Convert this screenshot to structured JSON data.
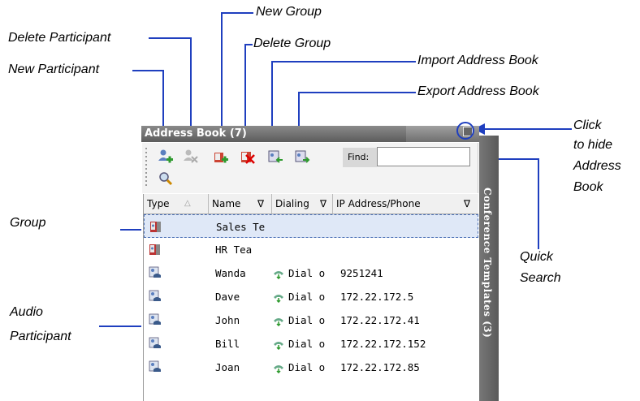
{
  "callouts": {
    "new_group": "New Group",
    "delete_participant": "Delete Participant",
    "delete_group": "Delete Group",
    "import_address_book": "Import Address Book",
    "new_participant": "New Participant",
    "export_address_book": "Export Address Book",
    "click_to_hide_1": "Click",
    "click_to_hide_2": "to hide",
    "click_to_hide_3": "Address",
    "click_to_hide_4": "Book",
    "group": "Group",
    "quick_search_1": "Quick",
    "quick_search_2": "Search",
    "audio_participant_1": "Audio",
    "audio_participant_2": "Participant"
  },
  "panel": {
    "title": "Address Book (7)",
    "find_label": "Find:",
    "find_value": "",
    "side_tab": "Conference Templates (3)"
  },
  "grid": {
    "headers": [
      "Type",
      "Name",
      "Dialing",
      "IP Address/Phone"
    ],
    "rows": [
      {
        "type_icon": "group-icon",
        "name": "Sales Te",
        "dialing": "",
        "address": ""
      },
      {
        "type_icon": "group-icon",
        "name": "HR Tea",
        "dialing": "",
        "address": ""
      },
      {
        "type_icon": "audio-participant-icon",
        "name": "Wanda",
        "dialing": "Dial o",
        "address": "9251241"
      },
      {
        "type_icon": "audio-participant-icon",
        "name": "Dave",
        "dialing": "Dial o",
        "address": "172.22.172.5"
      },
      {
        "type_icon": "audio-participant-icon",
        "name": "John",
        "dialing": "Dial o",
        "address": "172.22.172.41"
      },
      {
        "type_icon": "audio-participant-icon",
        "name": "Bill",
        "dialing": "Dial o",
        "address": "172.22.172.152"
      },
      {
        "type_icon": "audio-participant-icon",
        "name": "Joan",
        "dialing": "Dial o",
        "address": "172.22.172.85"
      }
    ]
  },
  "colors": {
    "callout_line": "#1f3fbf",
    "titlebar": "#6b6b6b",
    "selected_row": "#dfe8f7"
  }
}
